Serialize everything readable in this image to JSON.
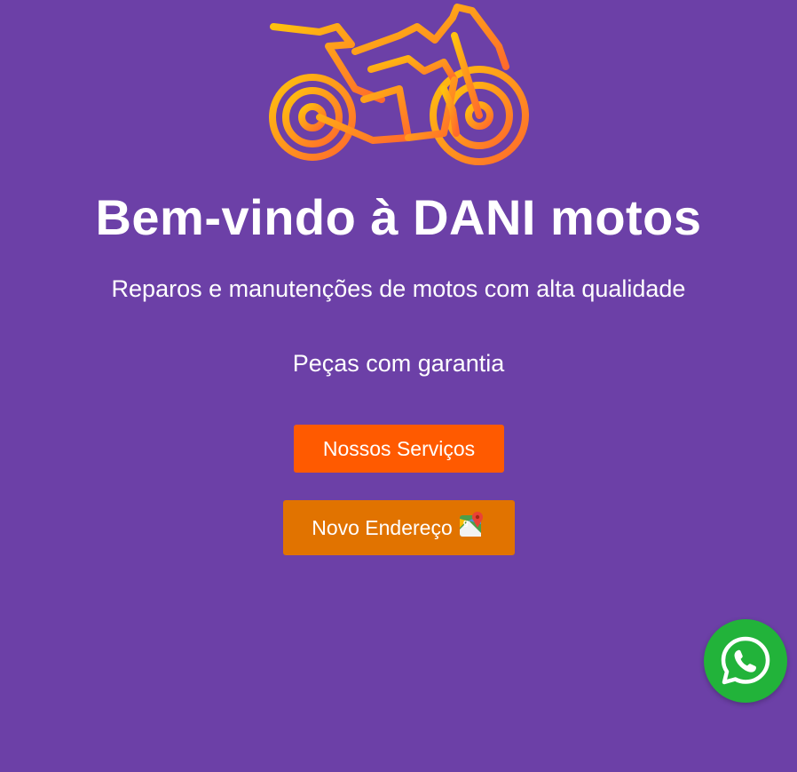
{
  "brand": {
    "logo_icon": "motorcycle-icon",
    "title": "Bem-vindo à DANI motos"
  },
  "taglines": [
    "Reparos e manutenções de motos com alta qualidade",
    "Peças com garantia"
  ],
  "buttons": {
    "services_label": "Nossos Serviços",
    "address_label": "Novo Endereço",
    "address_icon": "google-maps-icon"
  },
  "floating": {
    "whatsapp_icon": "whatsapp-icon"
  },
  "colors": {
    "background": "#6c40a7",
    "services_button": "#ff5a00",
    "address_button": "#e17300",
    "whatsapp": "#22b33a",
    "logo_gradient_start": "#ffc20e",
    "logo_gradient_end": "#ff6a2c"
  }
}
